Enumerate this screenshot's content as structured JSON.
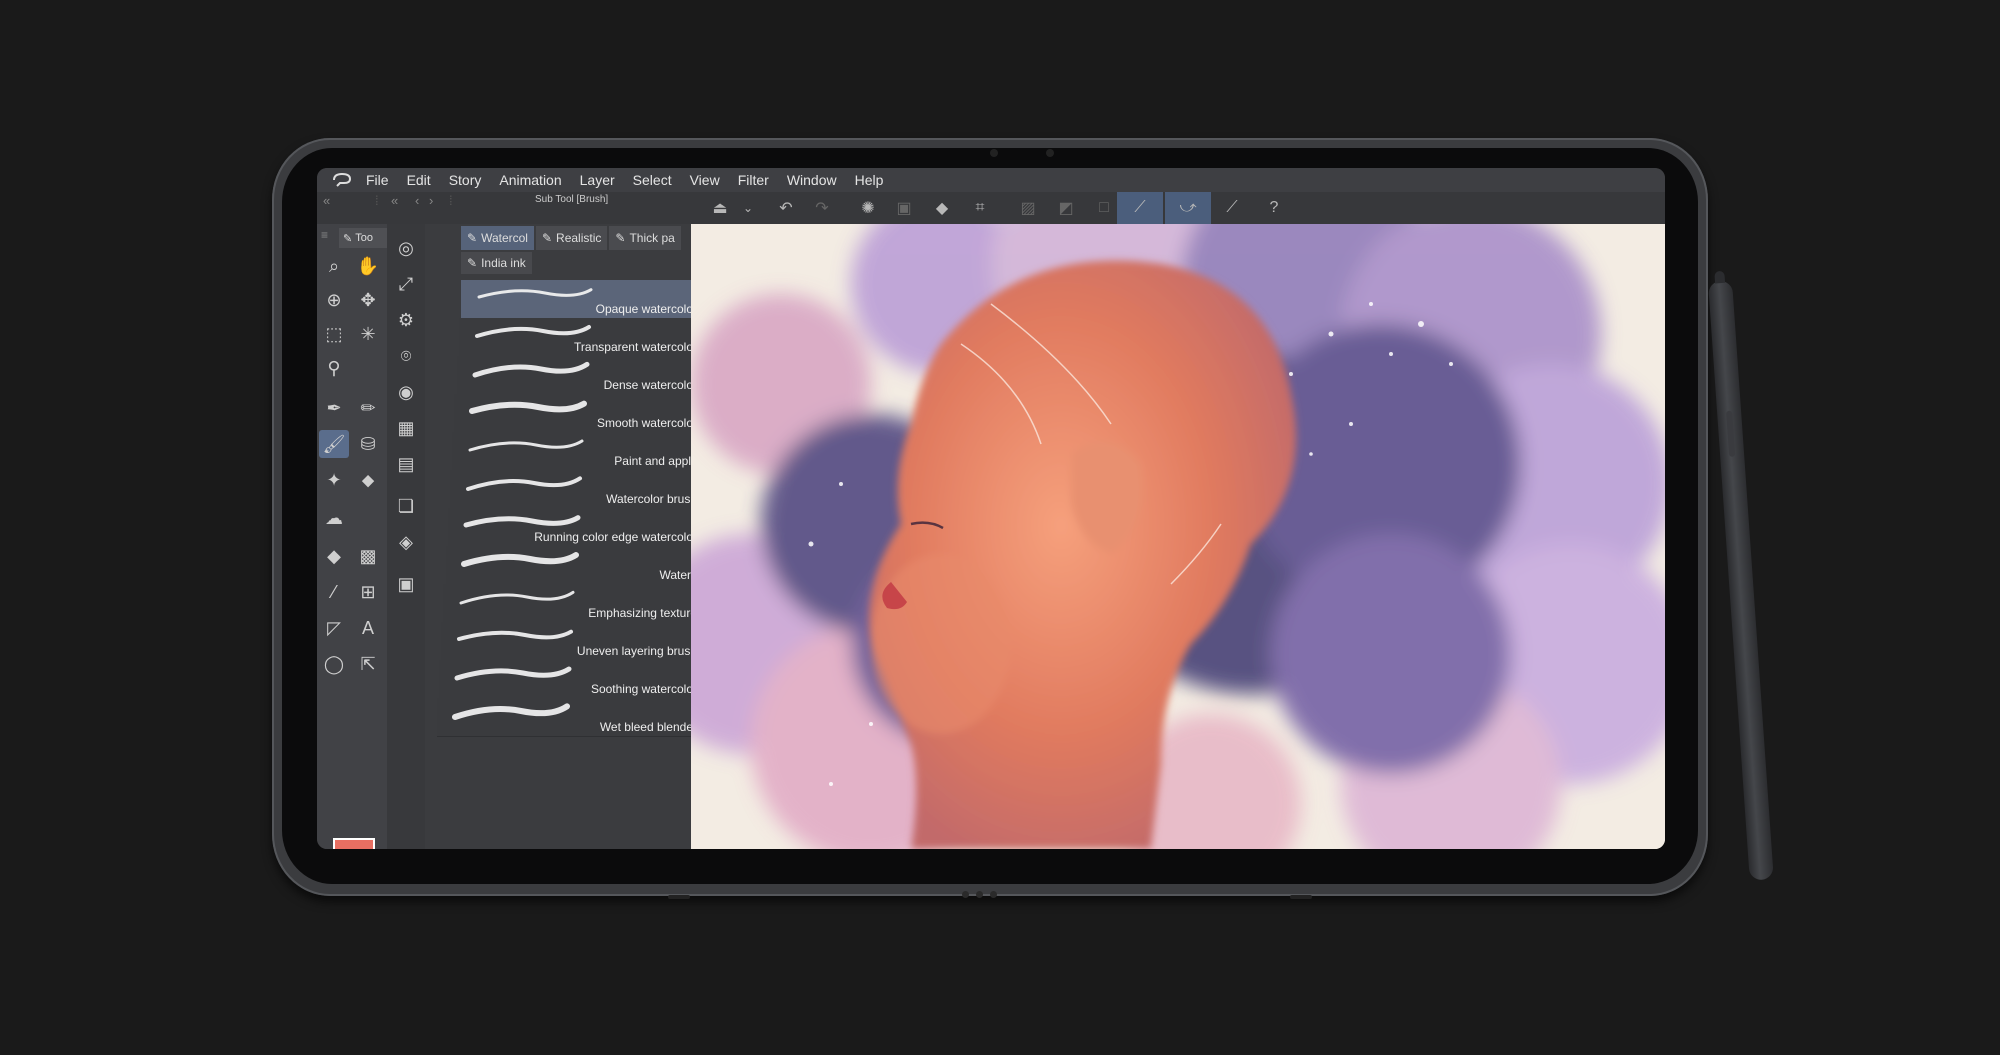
{
  "menu": {
    "items": [
      "File",
      "Edit",
      "Story",
      "Animation",
      "Layer",
      "Select",
      "View",
      "Filter",
      "Window",
      "Help"
    ]
  },
  "subtool": {
    "title": "Sub Tool [Brush]",
    "tabs": [
      "Watercol",
      "Realistic",
      "Thick pa"
    ],
    "tab2": "India ink",
    "brushes": [
      "Opaque watercolor",
      "Transparent watercolor",
      "Dense watercolor",
      "Smooth watercolor",
      "Paint and apply",
      "Watercolor brush",
      "Running color edge watercolor",
      "Watery",
      "Emphasizing texture",
      "Uneven layering brush",
      "Soothing watercolor",
      "Wet bleed blender"
    ],
    "selected_index": 0
  },
  "toolpalette": {
    "tab_label": "Too"
  },
  "colors": {
    "main": "#e86f62",
    "sub": "#ffffff",
    "accent": "#5a6d8c"
  },
  "icons": {
    "toolbar": [
      "fill-icon",
      "chevron-down-icon",
      "undo-icon",
      "redo-icon",
      "loading-icon",
      "copy-icon",
      "bucket-icon",
      "crop-icon",
      "deselect-icon",
      "gradient-icon",
      "frame-icon",
      "pen-active-icon",
      "brush-active-icon",
      "pencil-icon",
      "help-icon"
    ]
  }
}
